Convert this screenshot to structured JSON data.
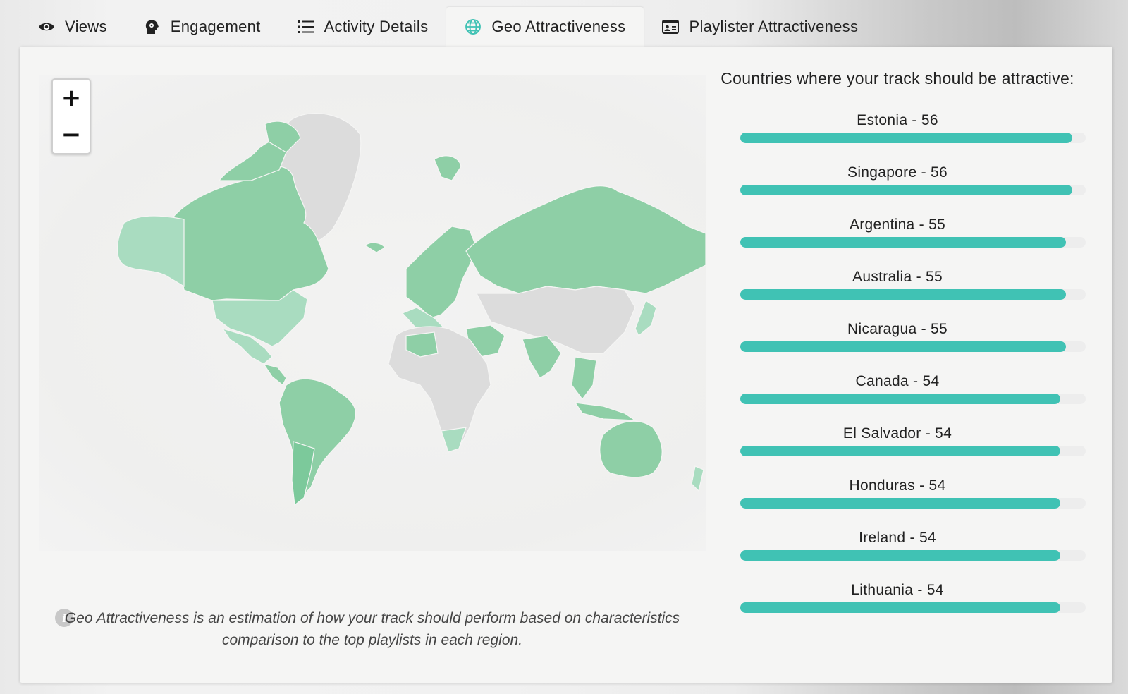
{
  "tabs": [
    {
      "label": "Views",
      "icon": "eye-icon"
    },
    {
      "label": "Engagement",
      "icon": "head-icon"
    },
    {
      "label": "Activity Details",
      "icon": "list-icon"
    },
    {
      "label": "Geo Attractiveness",
      "icon": "globe-icon",
      "active": true
    },
    {
      "label": "Playlister Attractiveness",
      "icon": "id-card-icon"
    }
  ],
  "map": {
    "zoom_in": "+",
    "zoom_out": "−"
  },
  "note": "Geo Attractiveness is an estimation of how your track should perform based on characteristics comparison to the top playlists in each region.",
  "countries_title": "Countries where your track should be attractive:",
  "countries": [
    {
      "label": "Estonia - 56",
      "score": 56
    },
    {
      "label": "Singapore - 56",
      "score": 56
    },
    {
      "label": "Argentina - 55",
      "score": 55
    },
    {
      "label": "Australia - 55",
      "score": 55
    },
    {
      "label": "Nicaragua - 55",
      "score": 55
    },
    {
      "label": "Canada - 54",
      "score": 54
    },
    {
      "label": "El Salvador - 54",
      "score": 54
    },
    {
      "label": "Honduras - 54",
      "score": 54
    },
    {
      "label": "Ireland - 54",
      "score": 54
    },
    {
      "label": "Lithuania - 54",
      "score": 54
    }
  ],
  "colors": {
    "accent": "#40c2b4",
    "map_high": "#8ecfa6",
    "map_low": "#dcdcdc"
  }
}
